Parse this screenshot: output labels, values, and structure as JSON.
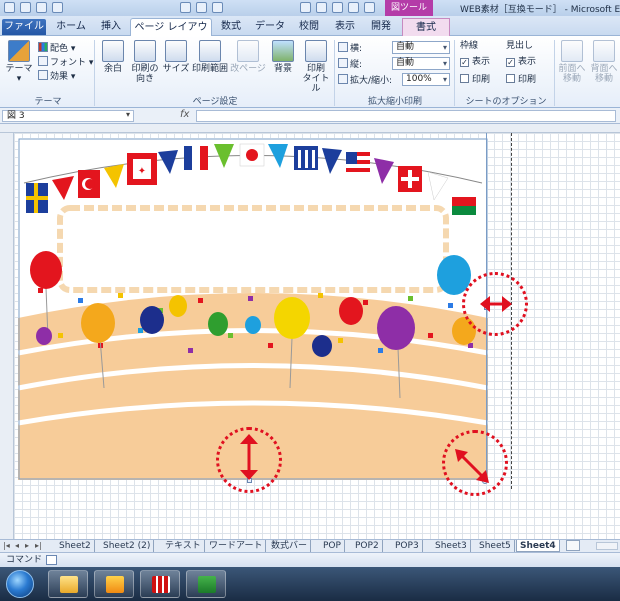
{
  "window": {
    "title": "WEB素材［互換モード］ - Microsoft E",
    "contextual_tab_header": "図ツール"
  },
  "tabs": [
    {
      "label": "ファイル"
    },
    {
      "label": "ホーム"
    },
    {
      "label": "挿入"
    },
    {
      "label": "ページ レイアウト"
    },
    {
      "label": "数式"
    },
    {
      "label": "データ"
    },
    {
      "label": "校閲"
    },
    {
      "label": "表示"
    },
    {
      "label": "開発"
    },
    {
      "label": "書式"
    }
  ],
  "ribbon": {
    "theme_group": {
      "label": "テーマ",
      "theme_button": "テーマ",
      "colors": "配色",
      "fonts": "フォント",
      "effects": "効果"
    },
    "page_setup_group": {
      "label": "ページ設定",
      "margins": "余白",
      "orientation_l1": "印刷の",
      "orientation_l2": "向き",
      "size": "サイズ",
      "print_area": "印刷範囲",
      "breaks": "改ページ",
      "background": "背景",
      "print_titles_l1": "印刷",
      "print_titles_l2": "タイトル"
    },
    "scale_group": {
      "label": "拡大縮小印刷",
      "width_label": "横:",
      "width_value": "自動",
      "height_label": "縦:",
      "height_value": "自動",
      "scale_label": "拡大/縮小:",
      "scale_value": "100%"
    },
    "sheet_options_group": {
      "label": "シートのオプション",
      "gridlines": "枠線",
      "headings": "見出し",
      "view": "表示",
      "print": "印刷",
      "view2": "表示",
      "print2": "印刷"
    },
    "arrange_group": {
      "bring_forward_l1": "前面へ",
      "bring_forward_l2": "移動",
      "send_backward_l1": "背面へ",
      "send_backward_l2": "移動"
    }
  },
  "formula_bar": {
    "name_box": "図 3",
    "fx": "fx"
  },
  "sheet_tabs": [
    {
      "label": "Sheet2"
    },
    {
      "label": "Sheet2 (2)"
    },
    {
      "label": "テキスト"
    },
    {
      "label": "ワードアート"
    },
    {
      "label": "数式バー"
    },
    {
      "label": "POP"
    },
    {
      "label": "POP2"
    },
    {
      "label": "POP3"
    },
    {
      "label": "Sheet3"
    },
    {
      "label": "Sheet5"
    },
    {
      "label": "Sheet4",
      "active": true
    }
  ],
  "status_bar": {
    "mode": "コマンド"
  },
  "colors": {
    "annotation": "#e01020",
    "banner_floor": "#f7cc99",
    "ribbon_bg": "#e6eef9",
    "contextual_tab": "#b43ca8"
  },
  "icons": {
    "start": "windows-start-orb",
    "explorer": "folder-icon",
    "outlook": "outlook-icon",
    "app": "red-grid-app-icon",
    "excel": "excel-icon"
  }
}
